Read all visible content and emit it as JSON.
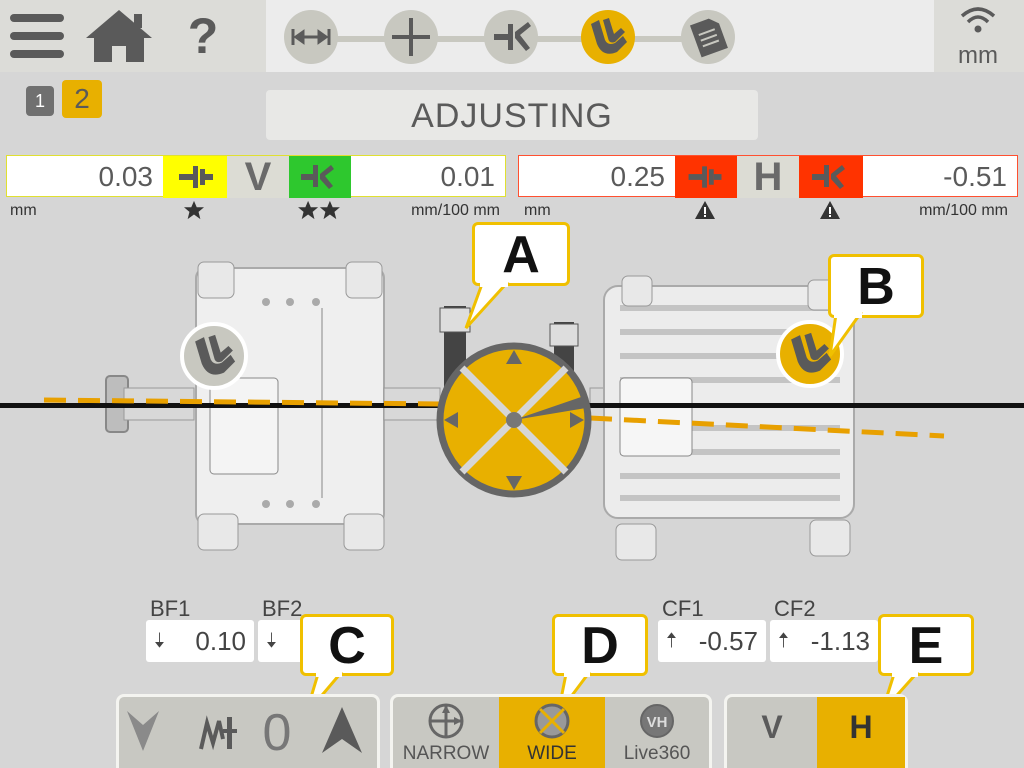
{
  "header": {
    "units": "mm",
    "steps": [
      {
        "name": "dimensions",
        "active": false
      },
      {
        "name": "measure",
        "active": false
      },
      {
        "name": "result",
        "active": false
      },
      {
        "name": "adjust",
        "active": true
      },
      {
        "name": "report",
        "active": false
      }
    ]
  },
  "pages": {
    "p1": "1",
    "p2": "2"
  },
  "title": "ADJUSTING",
  "vertical": {
    "offset_value": "0.03",
    "axis_label": "V",
    "angle_value": "0.01",
    "unit_left": "mm",
    "unit_right": "mm/100 mm",
    "offset_color": "#ffff00",
    "angle_color": "#2ec82e"
  },
  "horizontal": {
    "offset_value": "0.25",
    "axis_label": "H",
    "angle_value": "-0.51",
    "unit_left": "mm",
    "unit_right": "mm/100 mm",
    "status_color": "#ff3300"
  },
  "callouts": {
    "a": "A",
    "b": "B",
    "c": "C",
    "d": "D",
    "e": "E"
  },
  "feet": {
    "bf1": {
      "label": "BF1",
      "value": "0.10"
    },
    "bf2": {
      "label": "BF2",
      "value": ""
    },
    "cf1": {
      "label": "CF1",
      "value": "-0.57"
    },
    "cf2": {
      "label": "CF2",
      "value": "-1.13"
    }
  },
  "shim": {
    "count": "0"
  },
  "modes": {
    "narrow": "NARROW",
    "wide": "WIDE",
    "live": "Live360"
  },
  "direction": {
    "v": "V",
    "h": "H"
  },
  "colors": {
    "accent": "#e8b000",
    "warn": "#ff3300"
  }
}
